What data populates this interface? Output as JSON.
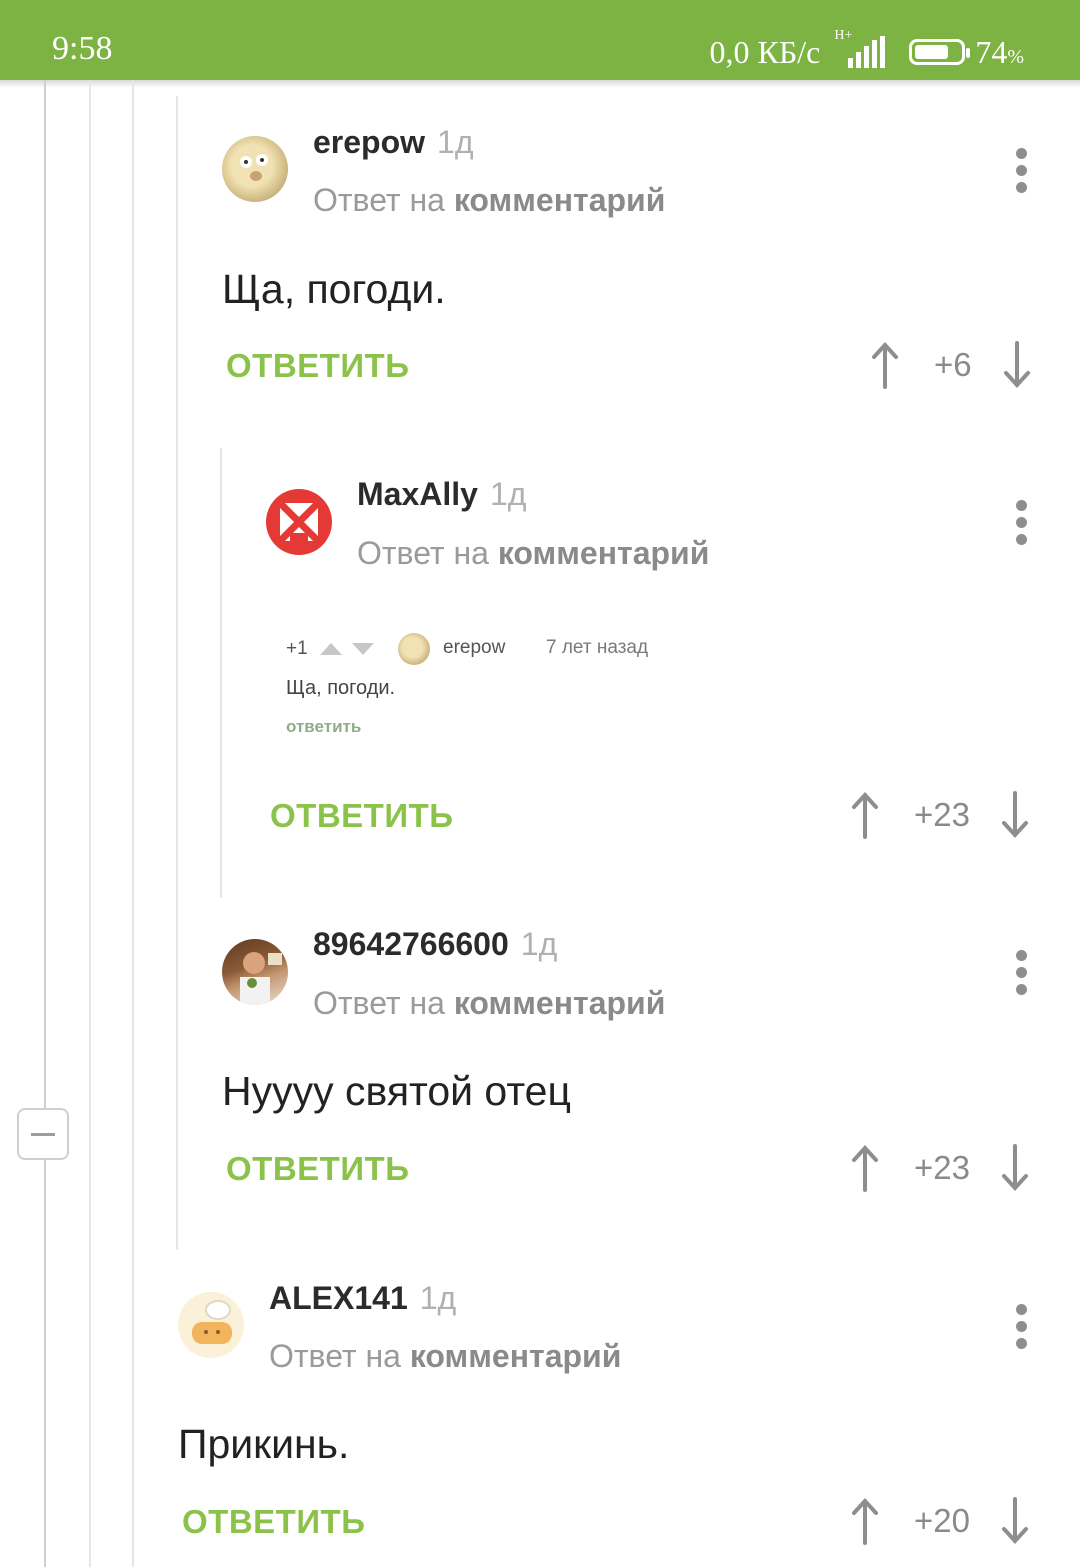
{
  "status_bar": {
    "time": "9:58",
    "network_speed": "0,0 КБ/с",
    "network_type": "H+",
    "battery_percent": "74",
    "battery_unit": "%",
    "battery_level": 0.74
  },
  "comments": [
    {
      "username": "erepow",
      "time": "1д",
      "reply_prefix": "Ответ на",
      "reply_target": "комментарий",
      "text": "Ща, погоди.",
      "reply_label": "ОТВЕТИТЬ",
      "score": "+6"
    },
    {
      "username": "MaxAlly",
      "time": "1д",
      "reply_prefix": "Ответ на",
      "reply_target": "комментарий",
      "embed": {
        "score": "+1",
        "username": "erepow",
        "time_ago": "7 лет назад",
        "text": "Ща, погоди.",
        "reply_label": "ответить"
      },
      "reply_label": "ОТВЕТИТЬ",
      "score": "+23"
    },
    {
      "username": "89642766600",
      "time": "1д",
      "reply_prefix": "Ответ на",
      "reply_target": "комментарий",
      "text": "Нуууу святой отец",
      "reply_label": "ОТВЕТИТЬ",
      "score": "+23"
    },
    {
      "username": "ALEX141",
      "time": "1д",
      "reply_prefix": "Ответ на",
      "reply_target": "комментарий",
      "text": "Прикинь.",
      "reply_label": "ОТВЕТИТЬ",
      "score": "+20"
    }
  ],
  "colors": {
    "status_bar": "#7cb342",
    "reply_button": "#8bc34a",
    "muted": "#9a9a9a"
  },
  "icons": [
    "more-vert-icon",
    "arrow-up-icon",
    "arrow-down-icon",
    "collapse-thread-icon",
    "signal-icon",
    "battery-icon"
  ]
}
